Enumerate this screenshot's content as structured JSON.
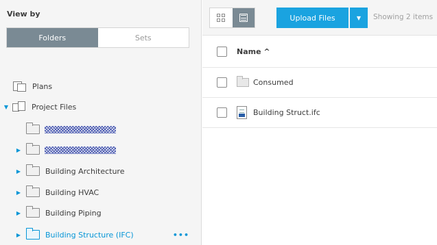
{
  "left_panel": {
    "view_by_label": "View by",
    "segments": {
      "folders": "Folders",
      "sets": "Sets"
    },
    "tree": {
      "plans": "Plans",
      "project_files": "Project Files",
      "folders": [
        {
          "label": "",
          "obscured": true
        },
        {
          "label": "",
          "obscured": true
        },
        {
          "label": "Building Architecture"
        },
        {
          "label": "Building HVAC"
        },
        {
          "label": "Building Piping"
        },
        {
          "label": "Building Structure (IFC)",
          "selected": true
        }
      ],
      "more_label": "•••"
    }
  },
  "right_panel": {
    "upload_label": "Upload Files",
    "showing_text": "Showing 2 items",
    "header_name": "Name ^",
    "rows": [
      {
        "label": "Consumed",
        "type": "folder"
      },
      {
        "label": "Building Struct.ifc",
        "type": "ifc-file"
      }
    ]
  },
  "colors": {
    "accent": "#0696d7",
    "upload_button": "#1aa3e0",
    "active_segment": "#7a8a94",
    "panel_bg": "#f5f5f5"
  }
}
